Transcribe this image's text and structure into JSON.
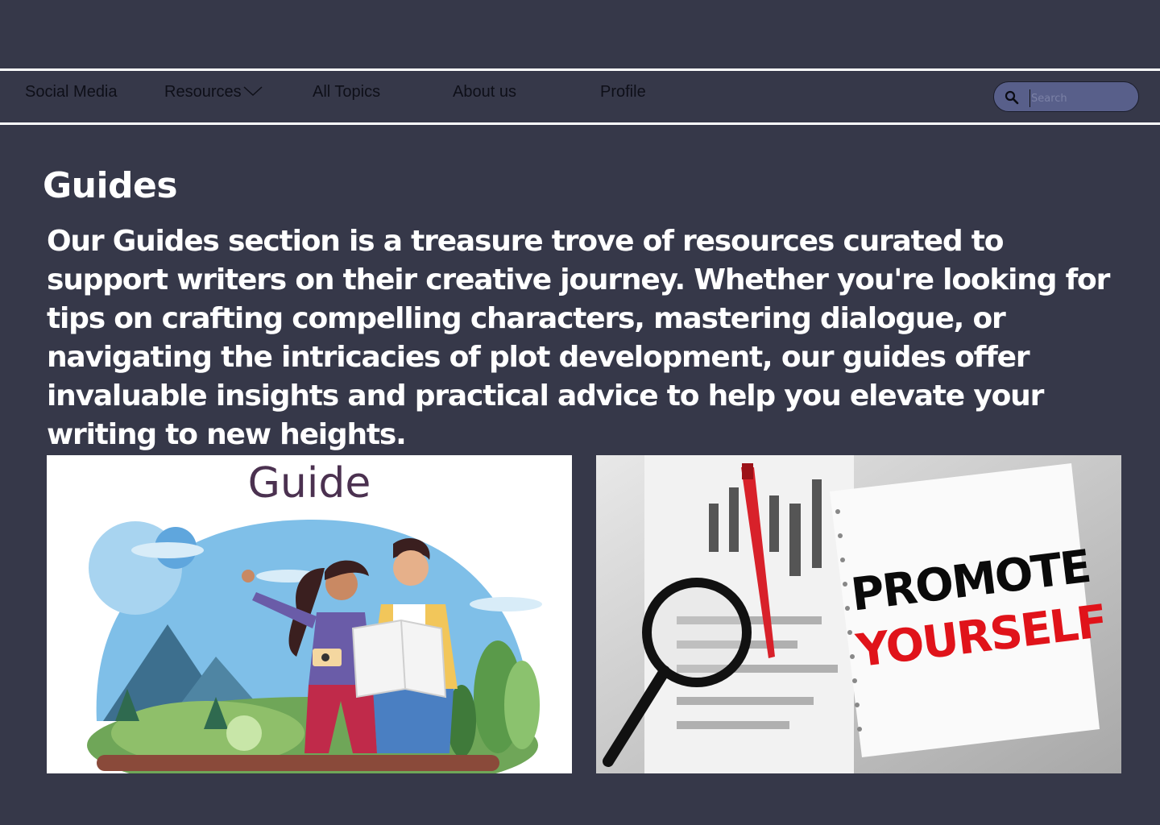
{
  "nav": {
    "items": [
      {
        "label": "Social Media"
      },
      {
        "label": "Resources"
      },
      {
        "label": "All Topics"
      },
      {
        "label": "About us"
      },
      {
        "label": "Profile"
      }
    ]
  },
  "search": {
    "placeholder": "Search"
  },
  "page": {
    "title": "Guides",
    "description": "Our Guides section is a treasure trove of resources curated to support writers on their creative journey. Whether you're looking for tips on crafting compelling characters, mastering dialogue, or navigating the intricacies of plot development, our guides offer invaluable insights and practical advice to help you elevate your writing to new heights."
  },
  "images": [
    {
      "caption": "Guide"
    },
    {
      "line1": "PROMOTE",
      "line2": "YOURSELF"
    }
  ]
}
